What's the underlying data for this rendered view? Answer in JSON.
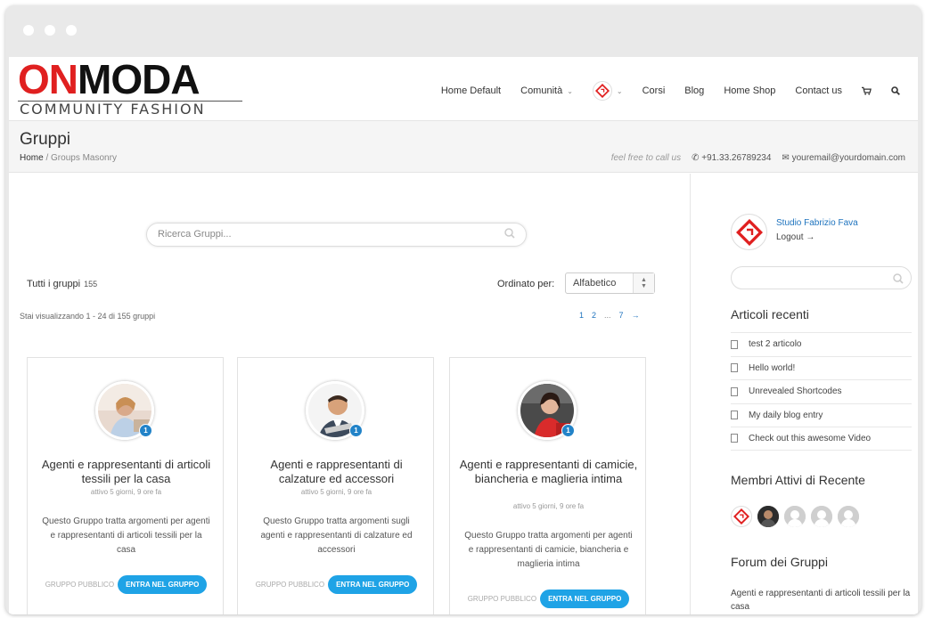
{
  "brand": {
    "logo_on": "ON",
    "logo_moda": "MODA",
    "logo_tagline": "COMMUNITY FASHION",
    "accent_color": "#e02020",
    "button_color": "#1fa3e6",
    "link_color": "#1e73be"
  },
  "nav": {
    "items": [
      {
        "label": "Home Default"
      },
      {
        "label": "Comunità"
      },
      {
        "label": "Corsi"
      },
      {
        "label": "Blog"
      },
      {
        "label": "Home Shop"
      },
      {
        "label": "Contact us"
      }
    ],
    "cart_icon": "cart-icon",
    "search_icon": "search-icon"
  },
  "titlebar": {
    "title": "Gruppi",
    "breadcrumb_home": "Home",
    "breadcrumb_sep": "/",
    "breadcrumb_current": "Groups Masonry",
    "feel_free": "feel free to call us",
    "phone": "+91.33.26789234",
    "email": "youremail@yourdomain.com"
  },
  "main": {
    "search_placeholder": "Ricerca Gruppi...",
    "all_groups_label": "Tutti i gruppi",
    "all_groups_count": "155",
    "order_label": "Ordinato per:",
    "order_value": "Alfabetico",
    "viewing_text": "Stai visualizzando 1 - 24 di 155 gruppi",
    "pagination": [
      "1",
      "2",
      "...",
      "7",
      "→"
    ]
  },
  "groups": [
    {
      "title": "Agenti e rappresentanti di articoli tessili per la casa",
      "active": "attivo 5 giorni, 9 ore fa",
      "description": "Questo Gruppo tratta argomenti per agenti e rappresentanti di articoli tessili per la casa",
      "badge": "1",
      "type": "GRUPPO PUBBLICO",
      "join": "ENTRA NEL GRUPPO"
    },
    {
      "title": "Agenti e rappresentanti di calzature ed accessori",
      "active": "attivo 5 giorni, 9 ore fa",
      "description": "Questo Gruppo tratta argomenti sugli agenti e rappresentanti di calzature ed accessori",
      "badge": "1",
      "type": "GRUPPO PUBBLICO",
      "join": "ENTRA NEL GRUPPO"
    },
    {
      "title": "Agenti e rappresentanti di camicie, biancheria e maglieria intima",
      "active": "attivo 5 giorni, 9 ore fa",
      "description": "Questo Gruppo tratta argomenti per agenti e rappresentanti di camicie, biancheria e maglieria intima",
      "badge": "1",
      "type": "GRUPPO PUBBLICO",
      "join": "ENTRA NEL GRUPPO"
    }
  ],
  "sidebar": {
    "user_name": "Studio Fabrizio Fava",
    "logout": "Logout →",
    "recent_heading": "Articoli recenti",
    "recent_items": [
      "test 2 articolo",
      "Hello world!",
      "Unrevealed Shortcodes",
      "My daily blog entry",
      "Check out this awesome Video"
    ],
    "members_heading": "Membri Attivi di Recente",
    "forum_heading": "Forum dei Gruppi",
    "forum_text": "Agenti e rappresentanti di articoli tessili per la casa"
  }
}
